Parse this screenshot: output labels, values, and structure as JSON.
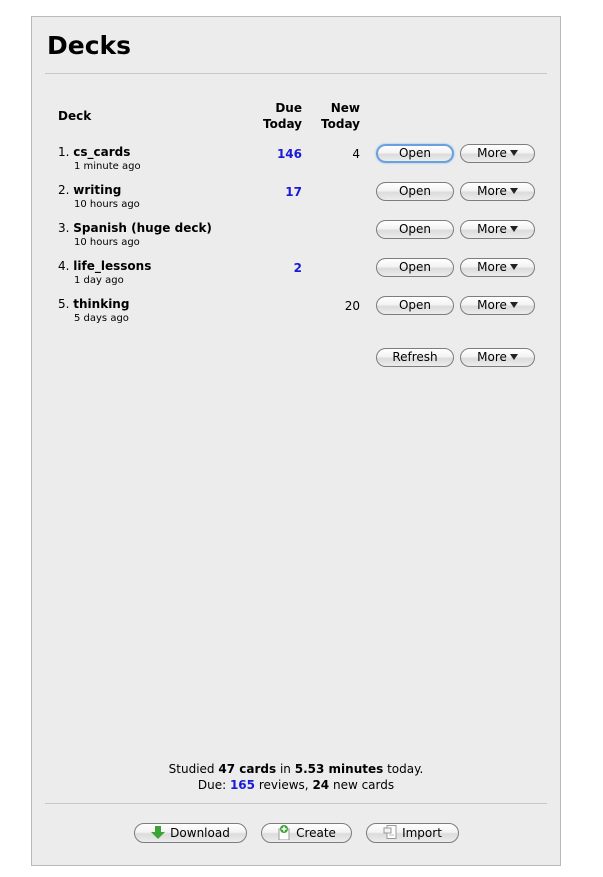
{
  "header": {
    "title": "Decks"
  },
  "columns": {
    "deck": "Deck",
    "due_line1": "Due",
    "due_line2": "Today",
    "new_line1": "New",
    "new_line2": "Today"
  },
  "decks": [
    {
      "index": "1.",
      "name": "cs_cards",
      "time": "1 minute ago",
      "due": "146",
      "new": "4",
      "open": "Open",
      "more": "More"
    },
    {
      "index": "2.",
      "name": "writing",
      "time": "10 hours ago",
      "due": "17",
      "new": "",
      "open": "Open",
      "more": "More"
    },
    {
      "index": "3.",
      "name": "Spanish (huge deck)",
      "time": "10 hours ago",
      "due": "",
      "new": "",
      "open": "Open",
      "more": "More"
    },
    {
      "index": "4.",
      "name": "life_lessons",
      "time": "1 day ago",
      "due": "2",
      "new": "",
      "open": "Open",
      "more": "More"
    },
    {
      "index": "5.",
      "name": "thinking",
      "time": "5 days ago",
      "due": "",
      "new": "20",
      "open": "Open",
      "more": "More"
    }
  ],
  "actions": {
    "refresh": "Refresh",
    "more": "More"
  },
  "summary": {
    "studied_prefix": "Studied",
    "cards_count": "47 cards",
    "in_word": "in",
    "minutes": "5.53 minutes",
    "today_word": "today.",
    "due_prefix": "Due:",
    "reviews_count": "165",
    "reviews_word": "reviews,",
    "new_count": "24",
    "new_word": "new cards"
  },
  "footer": {
    "download": "Download",
    "create": "Create",
    "import": "Import"
  },
  "icons": {
    "download": "download-arrow-icon",
    "create": "create-deck-icon",
    "import": "import-document-icon"
  },
  "colors": {
    "due_count": "#1a1ad8",
    "panel_bg": "#ececec",
    "focus_ring": "#6aa0dc"
  }
}
